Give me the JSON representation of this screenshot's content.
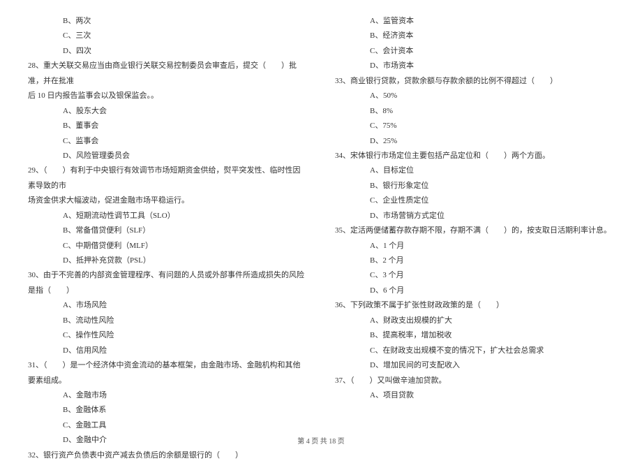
{
  "left": {
    "opts_pre": [
      "B、两次",
      "C、三次",
      "D、四次"
    ],
    "q28": "28、重大关联交易应当由商业银行关联交易控制委员会审查后，提交（　　）批准，并在批准",
    "q28_line2": "后 10 日内报告监事会以及银保监会。。",
    "q28_opts": [
      "A、股东大会",
      "B、董事会",
      "C、监事会",
      "D、风险管理委员会"
    ],
    "q29": "29、（　　）有利于中央银行有效调节市场短期资金供给，熨平突发性、临时性因素导致的市",
    "q29_line2": "场资金供求大幅波动，促进金融市场平稳运行。",
    "q29_opts": [
      "A、短期流动性调节工具（SLO）",
      "B、常备借贷便利（SLF）",
      "C、中期借贷便利（MLF）",
      "D、抵押补充贷款（PSL）"
    ],
    "q30": "30、由于不完善的内部资金管理程序、有问题的人员或外部事件所造成损失的风险是指（　　）",
    "q30_opts": [
      "A、市场风险",
      "B、流动性风险",
      "C、操作性风险",
      "D、信用风险"
    ],
    "q31": "31、（　　）是一个经济体中资金流动的基本框架，由金融市场、金融机构和其他要素组成。",
    "q31_opts": [
      "A、金融市场",
      "B、金融体系",
      "C、金融工具",
      "D、金融中介"
    ],
    "q32": "32、银行资产负债表中资产减去负债后的余额是银行的（　　）"
  },
  "right": {
    "q32_opts": [
      "A、监管资本",
      "B、经济资本",
      "C、会计资本",
      "D、市场资本"
    ],
    "q33": "33、商业银行贷款，贷款余额与存款余额的比例不得超过（　　）",
    "q33_opts": [
      "A、50%",
      "B、8%",
      "C、75%",
      "D、25%"
    ],
    "q34": "34、宋体银行市场定位主要包括产品定位和（　　）两个方面。",
    "q34_opts": [
      "A、目标定位",
      "B、银行形象定位",
      "C、企业性质定位",
      "D、市场营销方式定位"
    ],
    "q35": "35、定活两便储蓄存款存期不限，存期不满（　　）的，按支取日活期利率计息。",
    "q35_opts": [
      "A、1 个月",
      "B、2 个月",
      "C、3 个月",
      "D、6 个月"
    ],
    "q36": "36、下列政策不属于扩张性财政政策的是（　　）",
    "q36_opts": [
      "A、财政支出规模的扩大",
      "B、提高税率，增加税收",
      "C、在财政支出规模不变的情况下，扩大社会总需求",
      "D、增加民间的可支配收入"
    ],
    "q37": "37、（　　）又叫做辛迪加贷款。",
    "q37_opts": [
      "A、项目贷款"
    ]
  },
  "footer": "第 4 页 共 18 页"
}
